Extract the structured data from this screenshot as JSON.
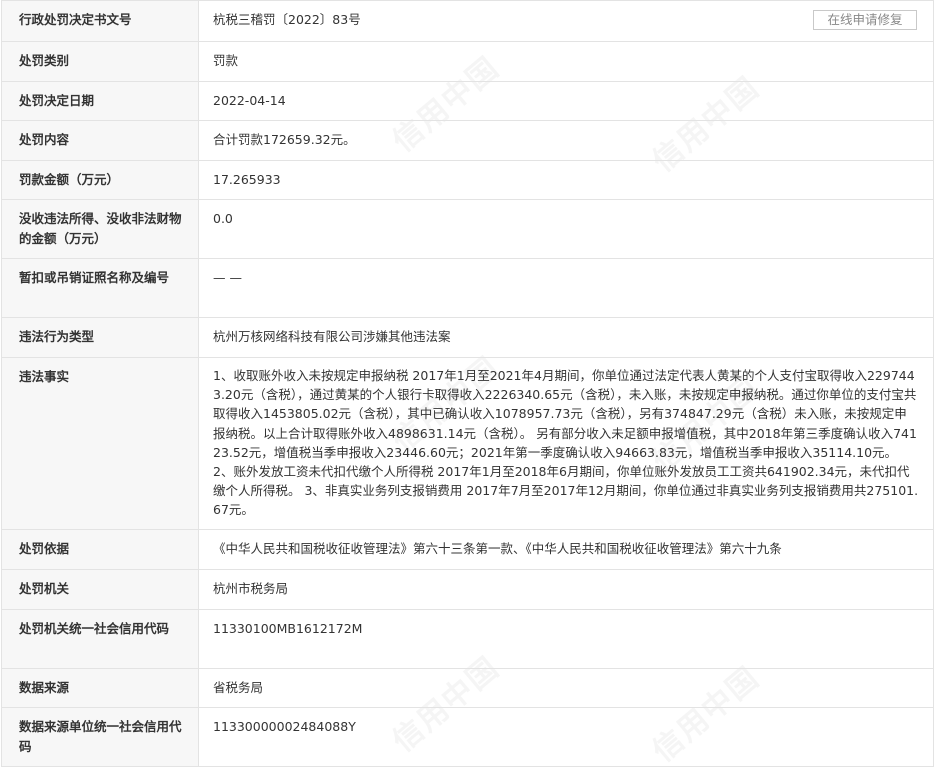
{
  "watermark": "信用中国",
  "header": {
    "repair_button": "在线申请修复"
  },
  "rows": [
    {
      "label": "行政处罚决定书文号",
      "value": "杭税三稽罚〔2022〕83号"
    },
    {
      "label": "处罚类别",
      "value": "罚款"
    },
    {
      "label": "处罚决定日期",
      "value": "2022-04-14"
    },
    {
      "label": "处罚内容",
      "value": "合计罚款172659.32元。"
    },
    {
      "label": "罚款金额（万元）",
      "value": "17.265933"
    },
    {
      "label": "没收违法所得、没收非法财物的金额（万元）",
      "value": "0.0"
    },
    {
      "label": "暂扣或吊销证照名称及编号",
      "value": "— —"
    },
    {
      "label": "违法行为类型",
      "value": "杭州万核网络科技有限公司涉嫌其他违法案"
    },
    {
      "label": "违法事实",
      "value": "1、收取账外收入未按规定申报纳税 2017年1月至2021年4月期间，你单位通过法定代表人黄某的个人支付宝取得收入2297443.20元（含税），通过黄某的个人银行卡取得收入2226340.65元（含税），未入账，未按规定申报纳税。通过你单位的支付宝共取得收入1453805.02元（含税），其中已确认收入1078957.73元（含税），另有374847.29元（含税）未入账，未按规定申报纳税。以上合计取得账外收入4898631.14元（含税）。 另有部分收入未足额申报增值税，其中2018年第三季度确认收入74123.52元，增值税当季申报收入23446.60元；2021年第一季度确认收入94663.83元，增值税当季申报收入35114.10元。 2、账外发放工资未代扣代缴个人所得税 2017年1月至2018年6月期间，你单位账外发放员工工资共641902.34元，未代扣代缴个人所得税。 3、非真实业务列支报销费用 2017年7月至2017年12月期间，你单位通过非真实业务列支报销费用共275101.67元。"
    },
    {
      "label": "处罚依据",
      "value": "《中华人民共和国税收征收管理法》第六十三条第一款、《中华人民共和国税收征收管理法》第六十九条"
    },
    {
      "label": "处罚机关",
      "value": "杭州市税务局"
    },
    {
      "label": "处罚机关统一社会信用代码",
      "value": "11330100MB1612172M"
    },
    {
      "label": "数据来源",
      "value": "省税务局"
    },
    {
      "label": "数据来源单位统一社会信用代码",
      "value": "11330000002484088Y"
    }
  ]
}
